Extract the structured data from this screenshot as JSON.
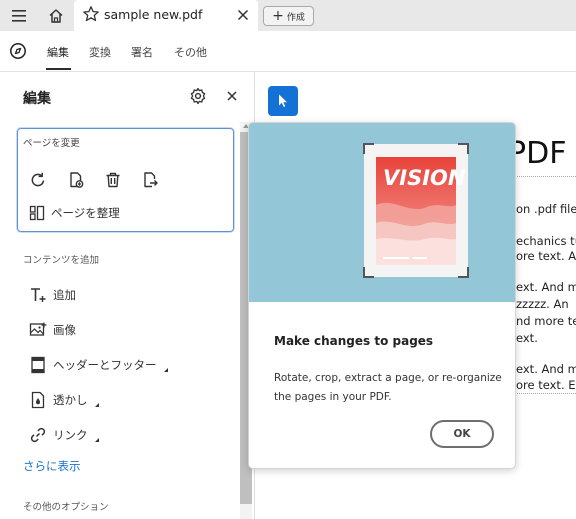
{
  "tabbar": {
    "menu_icon": "hamburger-icon",
    "home_icon": "home-icon",
    "tab_title": "sample new.pdf",
    "star_icon": "star-icon",
    "close_icon": "close-icon",
    "create_label": "作成",
    "create_icon": "plus-icon"
  },
  "toolbar": {
    "tools_icon": "tools-icon",
    "tabs": [
      {
        "label": "編集"
      },
      {
        "label": "変換"
      },
      {
        "label": "署名"
      },
      {
        "label": "その他"
      }
    ]
  },
  "panel": {
    "title": "編集",
    "gear_icon": "gear-icon",
    "close_icon": "close-icon",
    "page_section": {
      "label": "ページを変更",
      "icons": [
        "rotate-icon",
        "insert-page-icon",
        "delete-icon",
        "extract-page-icon"
      ],
      "organize_label": "ページを整理",
      "organize_icon": "organize-pages-icon"
    },
    "content_section": {
      "label": "コンテンツを追加",
      "items": [
        {
          "label": "追加",
          "icon": "add-text-icon"
        },
        {
          "label": "画像",
          "icon": "image-icon"
        },
        {
          "label": "ヘッダーとフッター",
          "icon": "header-footer-icon"
        },
        {
          "label": "透かし",
          "icon": "watermark-icon"
        },
        {
          "label": "リンク",
          "icon": "link-icon"
        }
      ],
      "more_label": "さらに表示"
    },
    "other_section": {
      "label": "その他のオプション"
    }
  },
  "document": {
    "select_icon": "cursor-arrow-icon",
    "heading": "PDF",
    "lines": [
      "on .pdf file",
      "echanics tu",
      "ore text. An",
      "ext. And m",
      " zzzzz. An",
      "nd more te",
      "ext.",
      "ext. And m",
      "ore text. Ev"
    ]
  },
  "coachmark": {
    "hero_text": "VISION",
    "title": "Make changes to pages",
    "body": "Rotate, crop, extract a page, or re-organize the pages in your PDF.",
    "ok_label": "OK",
    "colors": {
      "hero_bg": "#93c7d8",
      "poster_red": "#e8433a"
    }
  },
  "colors": {
    "accent": "#1471d6",
    "link": "#1a73c9"
  }
}
